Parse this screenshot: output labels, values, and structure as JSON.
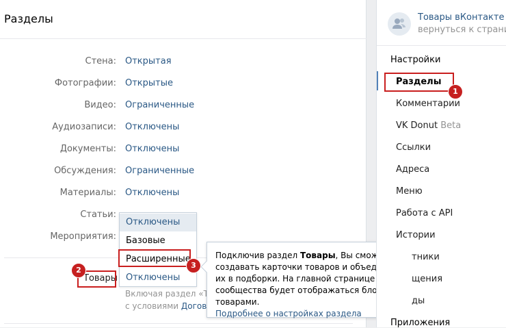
{
  "main": {
    "title": "Разделы",
    "rows": [
      {
        "label": "Стена:",
        "value": "Открытая"
      },
      {
        "label": "Фотографии:",
        "value": "Открытые"
      },
      {
        "label": "Видео:",
        "value": "Ограниченные"
      },
      {
        "label": "Аудиозаписи:",
        "value": "Отключены"
      },
      {
        "label": "Документы:",
        "value": "Отключены"
      },
      {
        "label": "Обсуждения:",
        "value": "Ограниченные"
      },
      {
        "label": "Материалы:",
        "value": "Отключены"
      },
      {
        "label": "Статьи:",
        "value": ""
      },
      {
        "label": "Мероприятия:",
        "value": ""
      }
    ],
    "goods_label": "Товары",
    "hint_line1": "Включая раздел «То",
    "hint_line2_prefix": "с условиями ",
    "hint_line2_link": "Догово"
  },
  "dropdown": {
    "options": [
      "Отключены",
      "Базовые",
      "Расширенные",
      "Отключены"
    ]
  },
  "tooltip": {
    "text_prefix": "Подключив раздел ",
    "text_bold": "Товары",
    "text_rest": ", Вы сможете создавать карточки товаров и объединять их в подборки. На главной странице сообщества будет отображаться блок с товарами.",
    "link": "Подробнее о настройках раздела"
  },
  "badges": [
    "1",
    "2",
    "3"
  ],
  "sidebar": {
    "avatar_icon": "users-icon",
    "title": "Товары вКонтакте",
    "subtitle": "вернуться к странице",
    "settings_label": "Настройки",
    "items": [
      {
        "label": "Разделы"
      },
      {
        "label": "Комментарии"
      },
      {
        "label": "VK Donut",
        "badge": "Beta"
      },
      {
        "label": "Ссылки"
      },
      {
        "label": "Адреса"
      },
      {
        "label": "Меню"
      },
      {
        "label": "Работа с API"
      },
      {
        "label": "Истории"
      },
      {
        "label": "тники"
      },
      {
        "label": "щения"
      },
      {
        "label": "ды"
      }
    ],
    "apps_label": "Приложения"
  },
  "colors": {
    "accent": "#2a5885",
    "highlight": "#c91e1e"
  }
}
